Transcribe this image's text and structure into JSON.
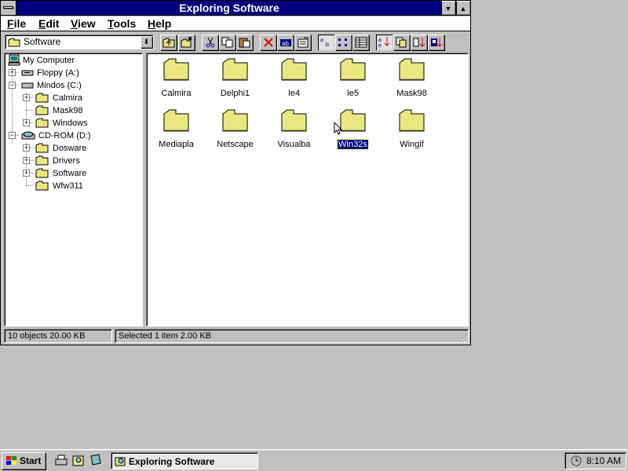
{
  "window": {
    "title": "Exploring Software"
  },
  "menu": [
    "File",
    "Edit",
    "View",
    "Tools",
    "Help"
  ],
  "toolbar": {
    "path": "Software",
    "buttons": [
      "up-one-level",
      "map-network-drive",
      "cut",
      "copy",
      "paste",
      "delete",
      "rename",
      "properties",
      "large-icons",
      "small-icons",
      "list",
      "details",
      "sort-by-name",
      "sort-by-type",
      "sort-by-size",
      "sort-by-date"
    ]
  },
  "tree": {
    "items": [
      {
        "label": "My Computer",
        "icon": "computer-icon"
      },
      {
        "label": "Floppy (A:)",
        "icon": "floppy-drive-icon"
      },
      {
        "label": "Mindos (C:)",
        "icon": "hard-drive-icon"
      },
      {
        "label": "Calmira",
        "icon": "folder-icon"
      },
      {
        "label": "Mask98",
        "icon": "folder-icon"
      },
      {
        "label": "Windows",
        "icon": "folder-icon"
      },
      {
        "label": "CD-ROM (D:)",
        "icon": "cdrom-drive-icon"
      },
      {
        "label": "Dosware",
        "icon": "folder-icon"
      },
      {
        "label": "Drivers",
        "icon": "folder-icon"
      },
      {
        "label": "Software",
        "icon": "folder-icon"
      },
      {
        "label": "Wfw311",
        "icon": "folder-icon"
      }
    ]
  },
  "files": [
    "Calmira",
    "Delphi1",
    "Ie4",
    "Ie5",
    "Mask98",
    "Mediapla",
    "Netscape",
    "Visualba",
    "Win32s",
    "Wingif"
  ],
  "selected_file": "Win32s",
  "status": {
    "objects": "10 objects  20.00 KB",
    "selection": "Selected 1 item  2.00 KB"
  },
  "taskbar": {
    "start": "Start",
    "task": "Exploring Software",
    "clock": "8:10 AM"
  },
  "colors": {
    "titlebar": "#000080",
    "folder": "#e8e880",
    "desktop": "#c0c0c0"
  }
}
